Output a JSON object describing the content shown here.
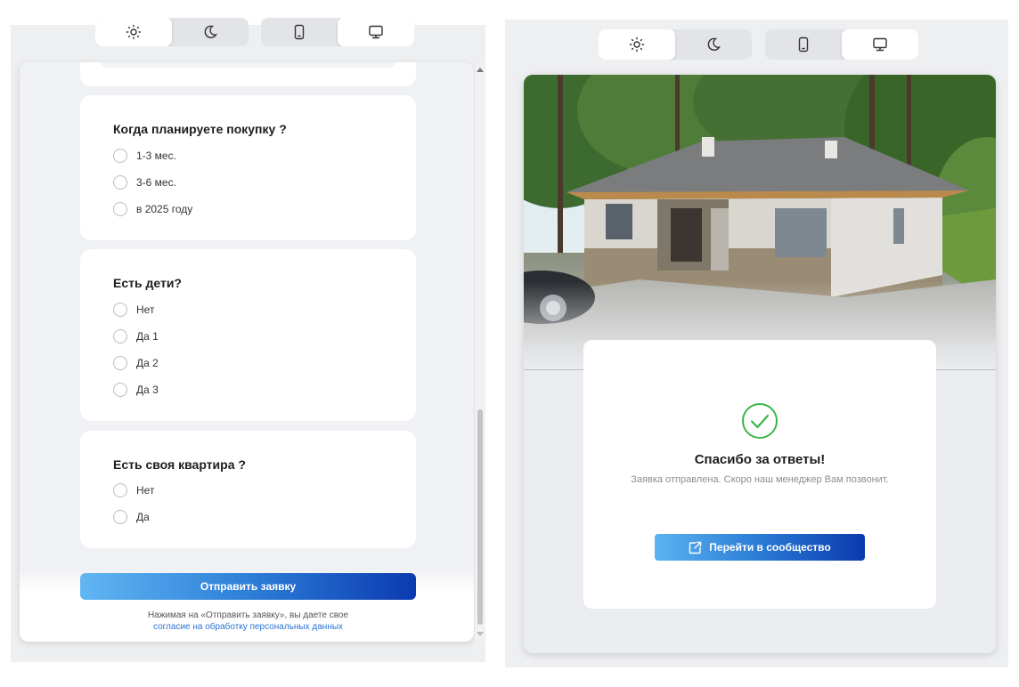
{
  "theme_toggle": {
    "light_icon": "sun-icon",
    "dark_icon": "moon-icon"
  },
  "device_toggle": {
    "mobile_icon": "phone-icon",
    "desktop_icon": "monitor-icon"
  },
  "left_form": {
    "questions": [
      {
        "title": "Когда планируете покупку ?",
        "options": [
          "1-3 мес.",
          "3-6 мес.",
          "в 2025 году"
        ]
      },
      {
        "title": "Есть дети?",
        "options": [
          "Нет",
          "Да 1",
          "Да 2",
          "Да 3"
        ]
      },
      {
        "title": "Есть своя квартира ?",
        "options": [
          "Нет",
          "Да"
        ]
      }
    ],
    "submit_label": "Отправить заявку",
    "consent_text": "Нажимая на «Отправить заявку», вы даете свое",
    "consent_link": "согласие на обработку персональных данных"
  },
  "right_result": {
    "check_icon": "check-circle-icon",
    "title": "Спасибо за ответы!",
    "subtitle": "Заявка отправлена. Скоро наш менеджер Вам позвонит.",
    "button_label": "Перейти в сообщество",
    "button_icon": "external-link-icon"
  },
  "colors": {
    "accent_start": "#62b6f2",
    "accent_end": "#0b3ab0",
    "success": "#3bb54a",
    "link": "#2a74d6"
  }
}
